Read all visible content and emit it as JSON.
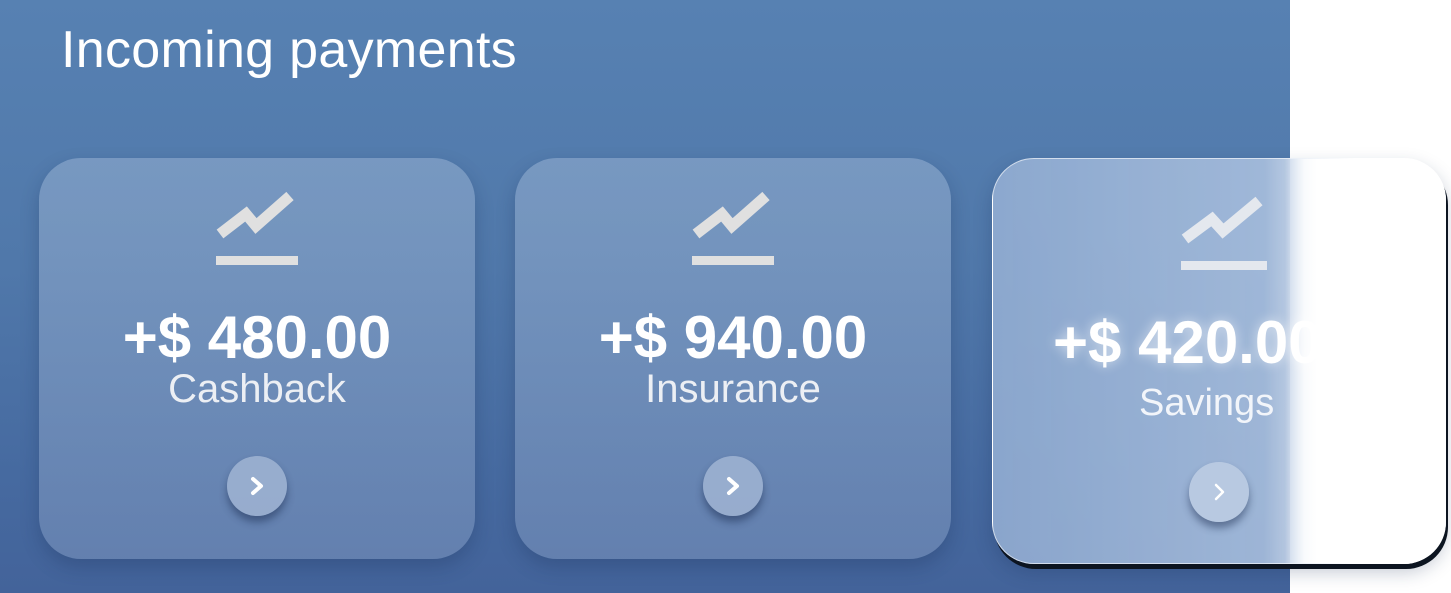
{
  "header": {
    "title": "Incoming payments"
  },
  "cards": [
    {
      "amount": "+$ 480.00",
      "label": "Cashback",
      "icon": "trending-up-icon",
      "action_icon": "chevron-right-icon"
    },
    {
      "amount": "+$ 940.00",
      "label": "Insurance",
      "icon": "trending-up-icon",
      "action_icon": "chevron-right-icon"
    },
    {
      "amount": "+$ 420.00",
      "label": "Savings",
      "icon": "trending-up-icon",
      "action_icon": "chevron-right-icon"
    }
  ],
  "colors": {
    "background": "#5781b2",
    "card_fill": "#7f9cc4",
    "text": "#ffffff",
    "icon": "#e0e0e0"
  }
}
